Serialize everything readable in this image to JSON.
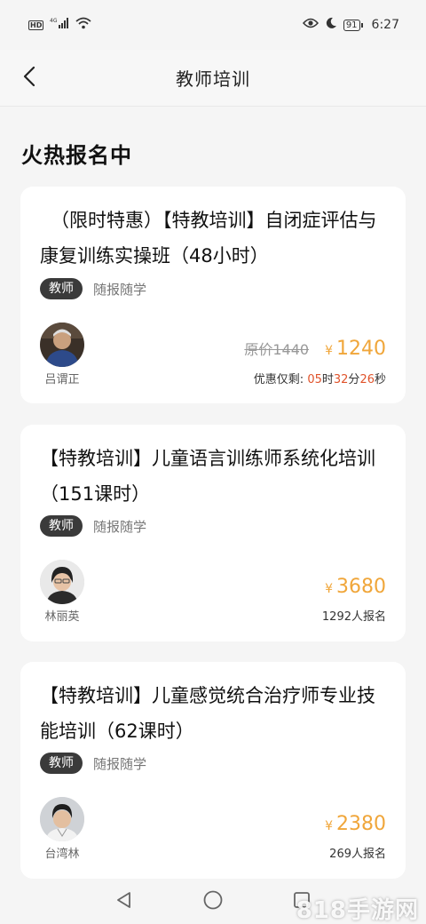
{
  "status_bar": {
    "network_badge": "HD",
    "signal_label": "4G",
    "battery": "91",
    "time": "6:27"
  },
  "navbar": {
    "title": "教师培训"
  },
  "section": {
    "title": "火热报名中"
  },
  "courses": [
    {
      "title": "（限时特惠）【特教培训】自闭症评估与康复训练实操班（48小时）",
      "tag_primary": "教师",
      "tag_secondary": "随报随学",
      "teacher": "吕谓正",
      "original_price": "原价1440",
      "yen": "¥",
      "price": "1240",
      "countdown_label": "优惠仅剩:",
      "countdown_hours": "05",
      "countdown_h_unit": "时",
      "countdown_minutes": "32",
      "countdown_m_unit": "分",
      "countdown_seconds": "26",
      "countdown_s_unit": "秒"
    },
    {
      "title": "【特教培训】儿童语言训练师系统化培训（151课时）",
      "tag_primary": "教师",
      "tag_secondary": "随报随学",
      "teacher": "林丽英",
      "yen": "¥",
      "price": "3680",
      "enrolled": "1292人报名"
    },
    {
      "title": "【特教培训】儿童感觉统合治疗师专业技能培训（62课时）",
      "tag_primary": "教师",
      "tag_secondary": "随报随学",
      "teacher": "台湾林",
      "yen": "¥",
      "price": "2380",
      "enrolled": "269人报名"
    }
  ],
  "watermark": "818手游网",
  "colors": {
    "accent_price": "#f0a63a",
    "countdown": "#e0532b",
    "tag_dark": "#3a3a3a",
    "background": "#f5f5f5"
  },
  "icons": [
    "back-arrow-icon",
    "eye-icon",
    "moon-icon",
    "wifi-icon",
    "signal-icon",
    "nav-back-icon",
    "nav-home-icon",
    "nav-recents-icon"
  ]
}
